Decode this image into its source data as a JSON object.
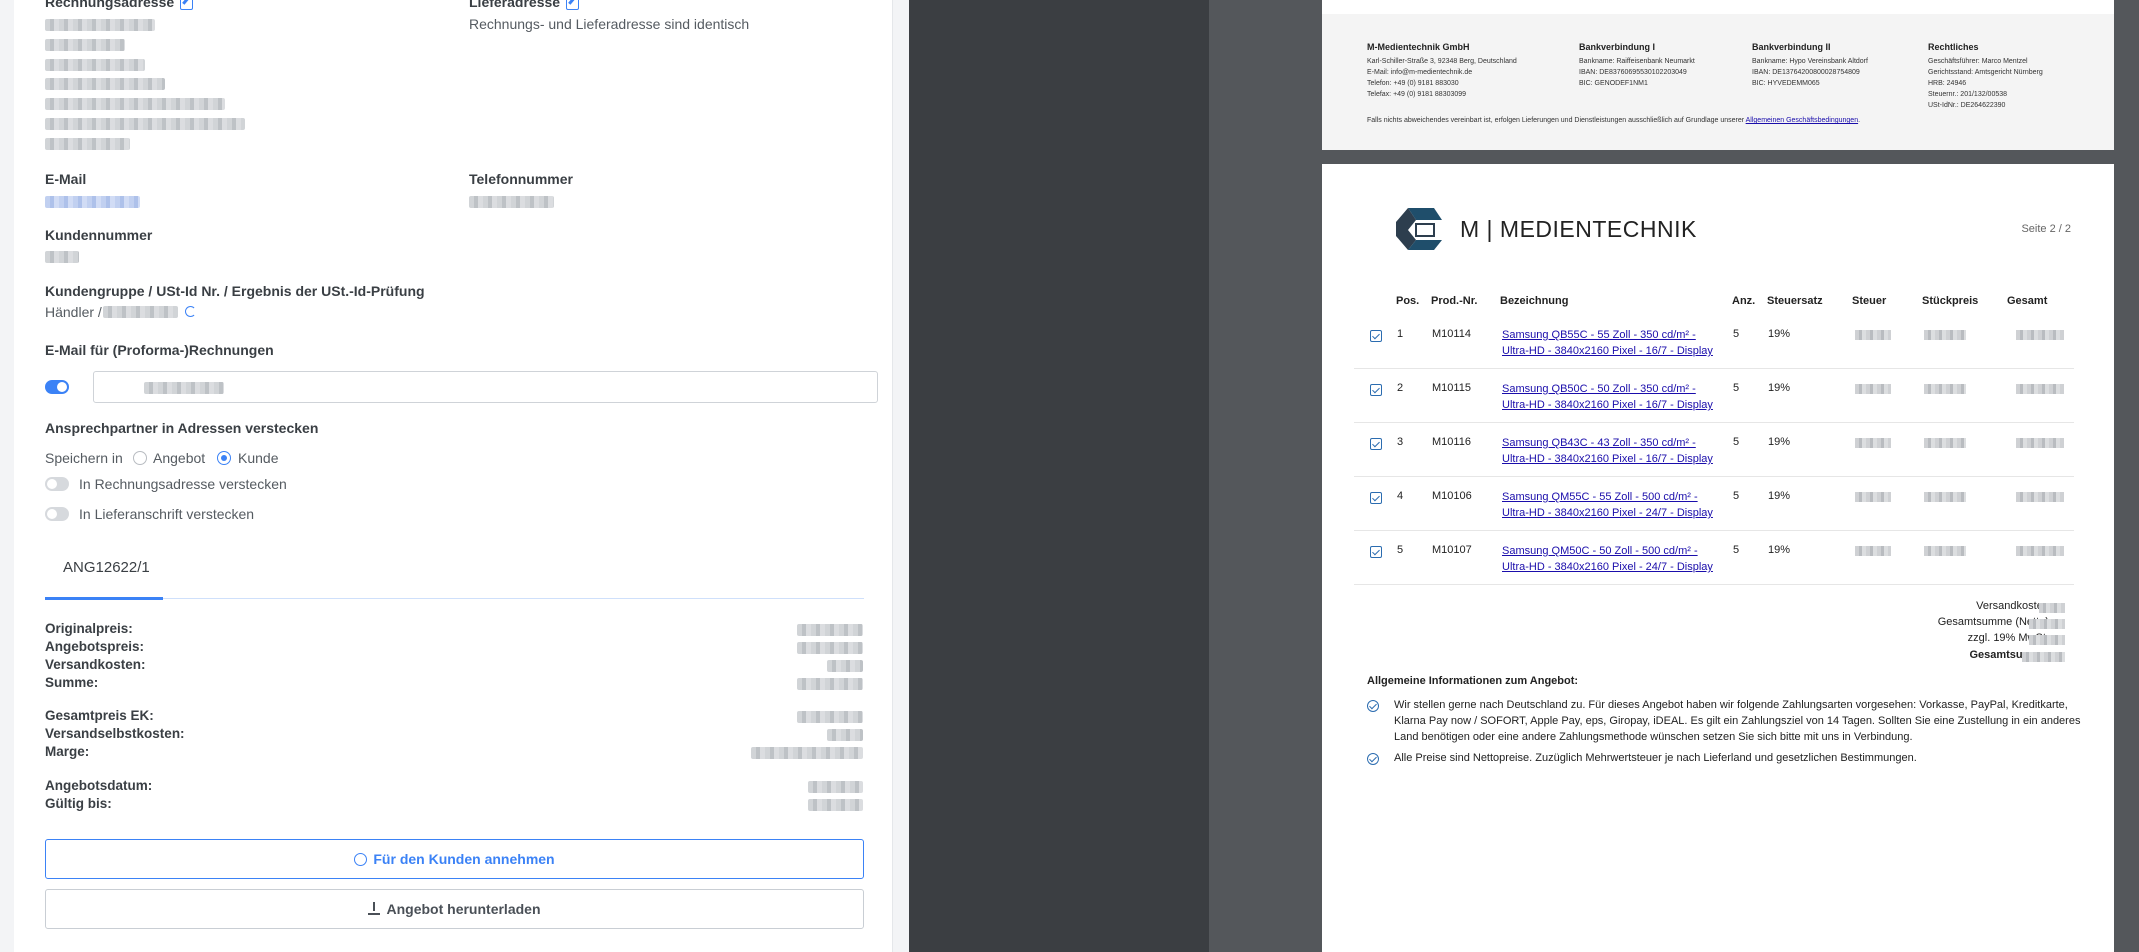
{
  "left": {
    "billing_label": "Rechnungsadresse",
    "shipping_label": "Lieferadresse",
    "shipping_note": "Rechnungs- und Lieferadresse sind identisch",
    "email_label": "E-Mail",
    "phone_label": "Telefonnummer",
    "customer_no_label": "Kundennummer",
    "customer_group_label": "Kundengruppe / USt-Id Nr. / Ergebnis der USt.-Id-Prüfung",
    "customer_group_value": "Händler /",
    "invoice_email_label": "E-Mail für (Proforma-)Rechnungen",
    "invoice_email_toggle_on": true,
    "contact_hide_label": "Ansprechpartner in Adressen verstecken",
    "save_in_label": "Speichern in",
    "save_options": [
      "Angebot",
      "Kunde"
    ],
    "save_selected": "Kunde",
    "hide_billing_label": "In Rechnungsadresse verstecken",
    "hide_shipping_label": "In Lieferanschrift verstecken",
    "tab_label": "ANG12622/1",
    "price_rows_1": [
      "Originalpreis:",
      "Angebotspreis:",
      "Versandkosten:",
      "Summe:"
    ],
    "price_rows_2": [
      "Gesamtpreis EK:",
      "Versandselbstkosten:",
      "Marge:"
    ],
    "date_rows": [
      "Angebotsdatum:",
      "Gültig bis:"
    ],
    "accept_button": "Für den Kunden annehmen",
    "download_button": "Angebot herunterladen"
  },
  "pdf": {
    "footer": {
      "col1_title": "M-Medientechnik GmbH",
      "col1_lines": [
        "Karl-Schiller-Straße 3, 92348 Berg, Deutschland",
        "E-Mail: info@m-medientechnik.de",
        "Telefon: +49 (0) 9181 883030",
        "Telefax: +49 (0) 9181 88303099"
      ],
      "col2_title": "Bankverbindung I",
      "col2_lines": [
        "Bankname: Raiffeisenbank Neumarkt",
        "IBAN: DE83760695530102203049",
        "BIC: GENODEF1NM1"
      ],
      "col3_title": "Bankverbindung II",
      "col3_lines": [
        "Bankname: Hypo Vereinsbank Altdorf",
        "IBAN: DE13764200800028754809",
        "BIC: HYVEDEMM065"
      ],
      "col4_title": "Rechtliches",
      "col4_lines": [
        "Geschäftsführer: Marco Mentzel",
        "Gerichtsstand: Amtsgericht Nürnberg",
        "HRB: 24946",
        "Steuernr.: 201/132/00538",
        "USt-IdNr.: DE264622390"
      ],
      "terms_text": "Falls nichts abweichendes vereinbart ist, erfolgen Lieferungen und Dienstleistungen ausschließlich auf Grundlage unserer",
      "terms_link": "Allgemeinen Geschäftsbedingungen"
    },
    "logo_text": "M | MEDIENTECHNIK",
    "page_label": "Seite 2 / 2",
    "columns": [
      "Pos.",
      "Prod.-Nr.",
      "Bezeichnung",
      "Anz.",
      "Steuersatz",
      "Steuer",
      "Stückpreis",
      "Gesamt"
    ],
    "rows": [
      {
        "pos": "1",
        "prod": "M10114",
        "line1": "Samsung QB55C - 55 Zoll - 350 cd/m² -",
        "line2": "Ultra-HD - 3840x2160 Pixel - 16/7 - Display",
        "qty": "5",
        "tax": "19%"
      },
      {
        "pos": "2",
        "prod": "M10115",
        "line1": "Samsung QB50C - 50 Zoll - 350 cd/m² -",
        "line2": "Ultra-HD - 3840x2160 Pixel - 16/7 - Display",
        "qty": "5",
        "tax": "19%"
      },
      {
        "pos": "3",
        "prod": "M10116",
        "line1": "Samsung QB43C - 43 Zoll - 350 cd/m² -",
        "line2": "Ultra-HD - 3840x2160 Pixel - 16/7 - Display",
        "qty": "5",
        "tax": "19%"
      },
      {
        "pos": "4",
        "prod": "M10106",
        "line1": "Samsung QM55C - 55 Zoll - 500 cd/m² -",
        "line2": "Ultra-HD - 3840x2160 Pixel - 24/7 - Display",
        "qty": "5",
        "tax": "19%"
      },
      {
        "pos": "5",
        "prod": "M10107",
        "line1": "Samsung QM50C - 50 Zoll - 500 cd/m² -",
        "line2": "Ultra-HD - 3840x2160 Pixel - 24/7 - Display",
        "qty": "5",
        "tax": "19%"
      }
    ],
    "totals": [
      "Versandkosten:",
      "Gesamtsumme (Netto):",
      "zzgl. 19% MwSt.:",
      "Gesamtsumme:"
    ],
    "info_heading": "Allgemeine Informationen zum Angebot:",
    "info_1": "Wir stellen gerne nach Deutschland zu. Für dieses Angebot haben wir folgende Zahlungsarten vorgesehen: Vorkasse, PayPal, Kreditkarte, Klarna Pay now / SOFORT, Apple Pay, eps, Giropay, iDEAL. Es gilt ein Zahlungsziel von 14 Tagen. Sollten Sie eine Zustellung in ein anderes Land benötigen oder eine andere Zahlungsmethode wünschen setzen Sie sich bitte mit uns in Verbindung.",
    "info_2": "Alle Preise sind Nettopreise. Zuzüglich Mehrwertsteuer je nach Lieferland und gesetzlichen Bestimmungen."
  },
  "colors": {
    "accent": "#3b82f6",
    "link": "#1a0dab",
    "logo": "#1f4e6b"
  }
}
